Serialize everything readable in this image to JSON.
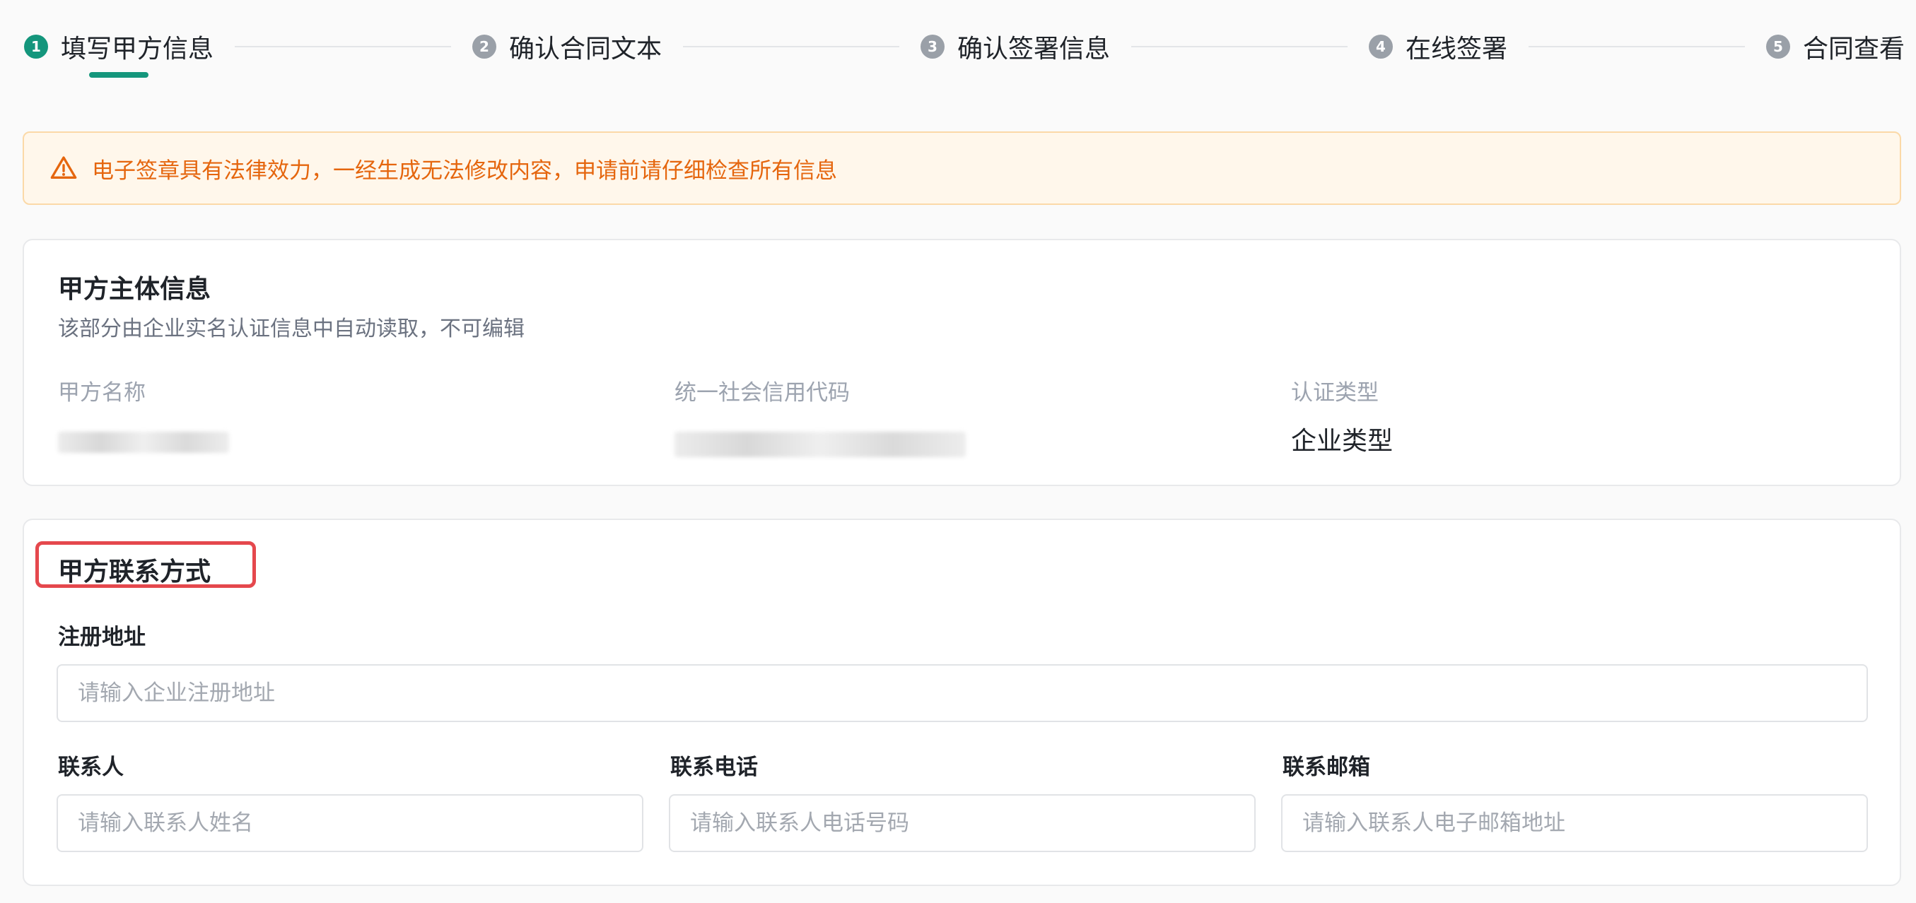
{
  "steps": [
    {
      "num": "1",
      "label": "填写甲方信息"
    },
    {
      "num": "2",
      "label": "确认合同文本"
    },
    {
      "num": "3",
      "label": "确认签署信息"
    },
    {
      "num": "4",
      "label": "在线签署"
    },
    {
      "num": "5",
      "label": "合同查看"
    }
  ],
  "warning": {
    "text": "电子签章具有法律效力，一经生成无法修改内容，申请前请仔细检查所有信息"
  },
  "entity": {
    "title": "甲方主体信息",
    "desc": "该部分由企业实名认证信息中自动读取，不可编辑",
    "fields": [
      {
        "label": "甲方名称",
        "value": ""
      },
      {
        "label": "统一社会信用代码",
        "value": ""
      },
      {
        "label": "认证类型",
        "value": "企业类型"
      }
    ]
  },
  "contact": {
    "title": "甲方联系方式",
    "address_label": "注册地址",
    "address_placeholder": "请输入企业注册地址",
    "person_label": "联系人",
    "person_placeholder": "请输入联系人姓名",
    "phone_label": "联系电话",
    "phone_placeholder": "请输入联系人电话号码",
    "email_label": "联系邮箱",
    "email_placeholder": "请输入联系人电子邮箱地址"
  },
  "colors": {
    "accent": "#14967c",
    "warning_text": "#e5660e",
    "warning_bg": "#fff7eb",
    "highlight": "#e5484d"
  }
}
